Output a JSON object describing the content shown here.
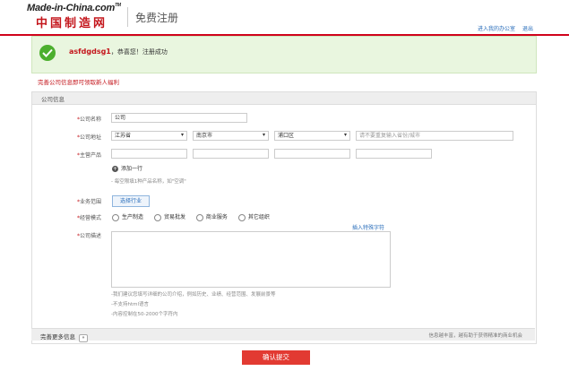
{
  "header": {
    "logo_top": "Made-in-China.com",
    "logo_domain": "TM",
    "logo_bottom": "中国制造网",
    "title": "免费注册",
    "links": [
      "进入我的办公室",
      "退出"
    ]
  },
  "success": {
    "username": "asfdgdsg1",
    "message": "，恭喜您！注册成功"
  },
  "hint": "完善公司信息即可领取新人福利",
  "section_title": "公司信息",
  "form": {
    "company_name": {
      "label": "公司名称",
      "value": "公司"
    },
    "address": {
      "label": "公司地址",
      "province": "江苏省",
      "city": "南京市",
      "district": "浦口区",
      "street_placeholder": "请不要重复输入省份/城市"
    },
    "products": {
      "label": "主营产品"
    },
    "add_row": "添加一行",
    "product_note": "- 每空限填1种产品名称，如\"空调\"",
    "industry": {
      "label": "业务范围",
      "button": "选择行业"
    },
    "mode": {
      "label": "经营模式",
      "options": [
        "生产制造",
        "贸易批发",
        "商业服务",
        "其它组织"
      ]
    },
    "description": {
      "label": "公司描述",
      "special_link": "插入特殊字符",
      "notes": [
        "-我们建议您填写详细的公司介绍，例如历史、业绩、经营范围、发展前景等",
        "-不支持html语言",
        "-内容控制在50-2000个字符内"
      ]
    }
  },
  "more": {
    "label": "完善更多信息",
    "chevron": "»",
    "tip": "信息越丰富，越有助于获得精准的商业机会"
  },
  "submit": "确认提交",
  "colors": {
    "brand_red": "#c4161c",
    "button_red": "#e23a32",
    "success_bg": "#e9f6df",
    "link_blue": "#2a6ebb"
  }
}
